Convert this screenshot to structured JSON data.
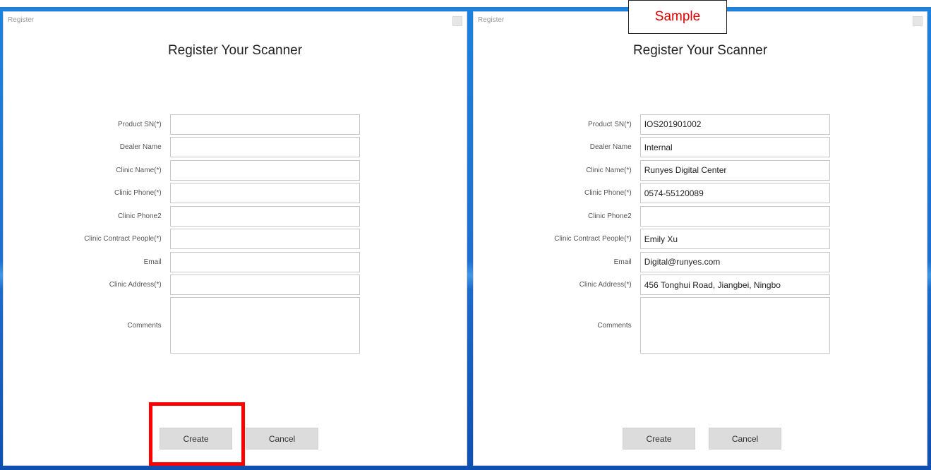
{
  "window": {
    "caption": "Register",
    "title": "Register Your Scanner"
  },
  "labels": {
    "product_sn": "Product SN(*)",
    "dealer_name": "Dealer Name",
    "clinic_name": "Clinic Name(*)",
    "clinic_phone": "Clinic Phone(*)",
    "clinic_phone2": "Clinic Phone2",
    "clinic_contact": "Clinic Contract People(*)",
    "email": "Email",
    "clinic_address": "Clinic Address(*)",
    "comments": "Comments"
  },
  "buttons": {
    "create": "Create",
    "cancel": "Cancel"
  },
  "sample": {
    "tag": "Sample",
    "values": {
      "product_sn": "IOS201901002",
      "dealer_name": "Internal",
      "clinic_name": "Runyes Digital Center",
      "clinic_phone": "0574-55120089",
      "clinic_phone2": "",
      "clinic_contact": "Emily Xu",
      "email": "Digital@runyes.com",
      "clinic_address": "456 Tonghui Road, Jiangbei, Ningbo",
      "comments": ""
    }
  },
  "colors": {
    "highlight": "#ff0000",
    "sample_text": "#e00000",
    "wallpaper": "#1e6fcf"
  }
}
